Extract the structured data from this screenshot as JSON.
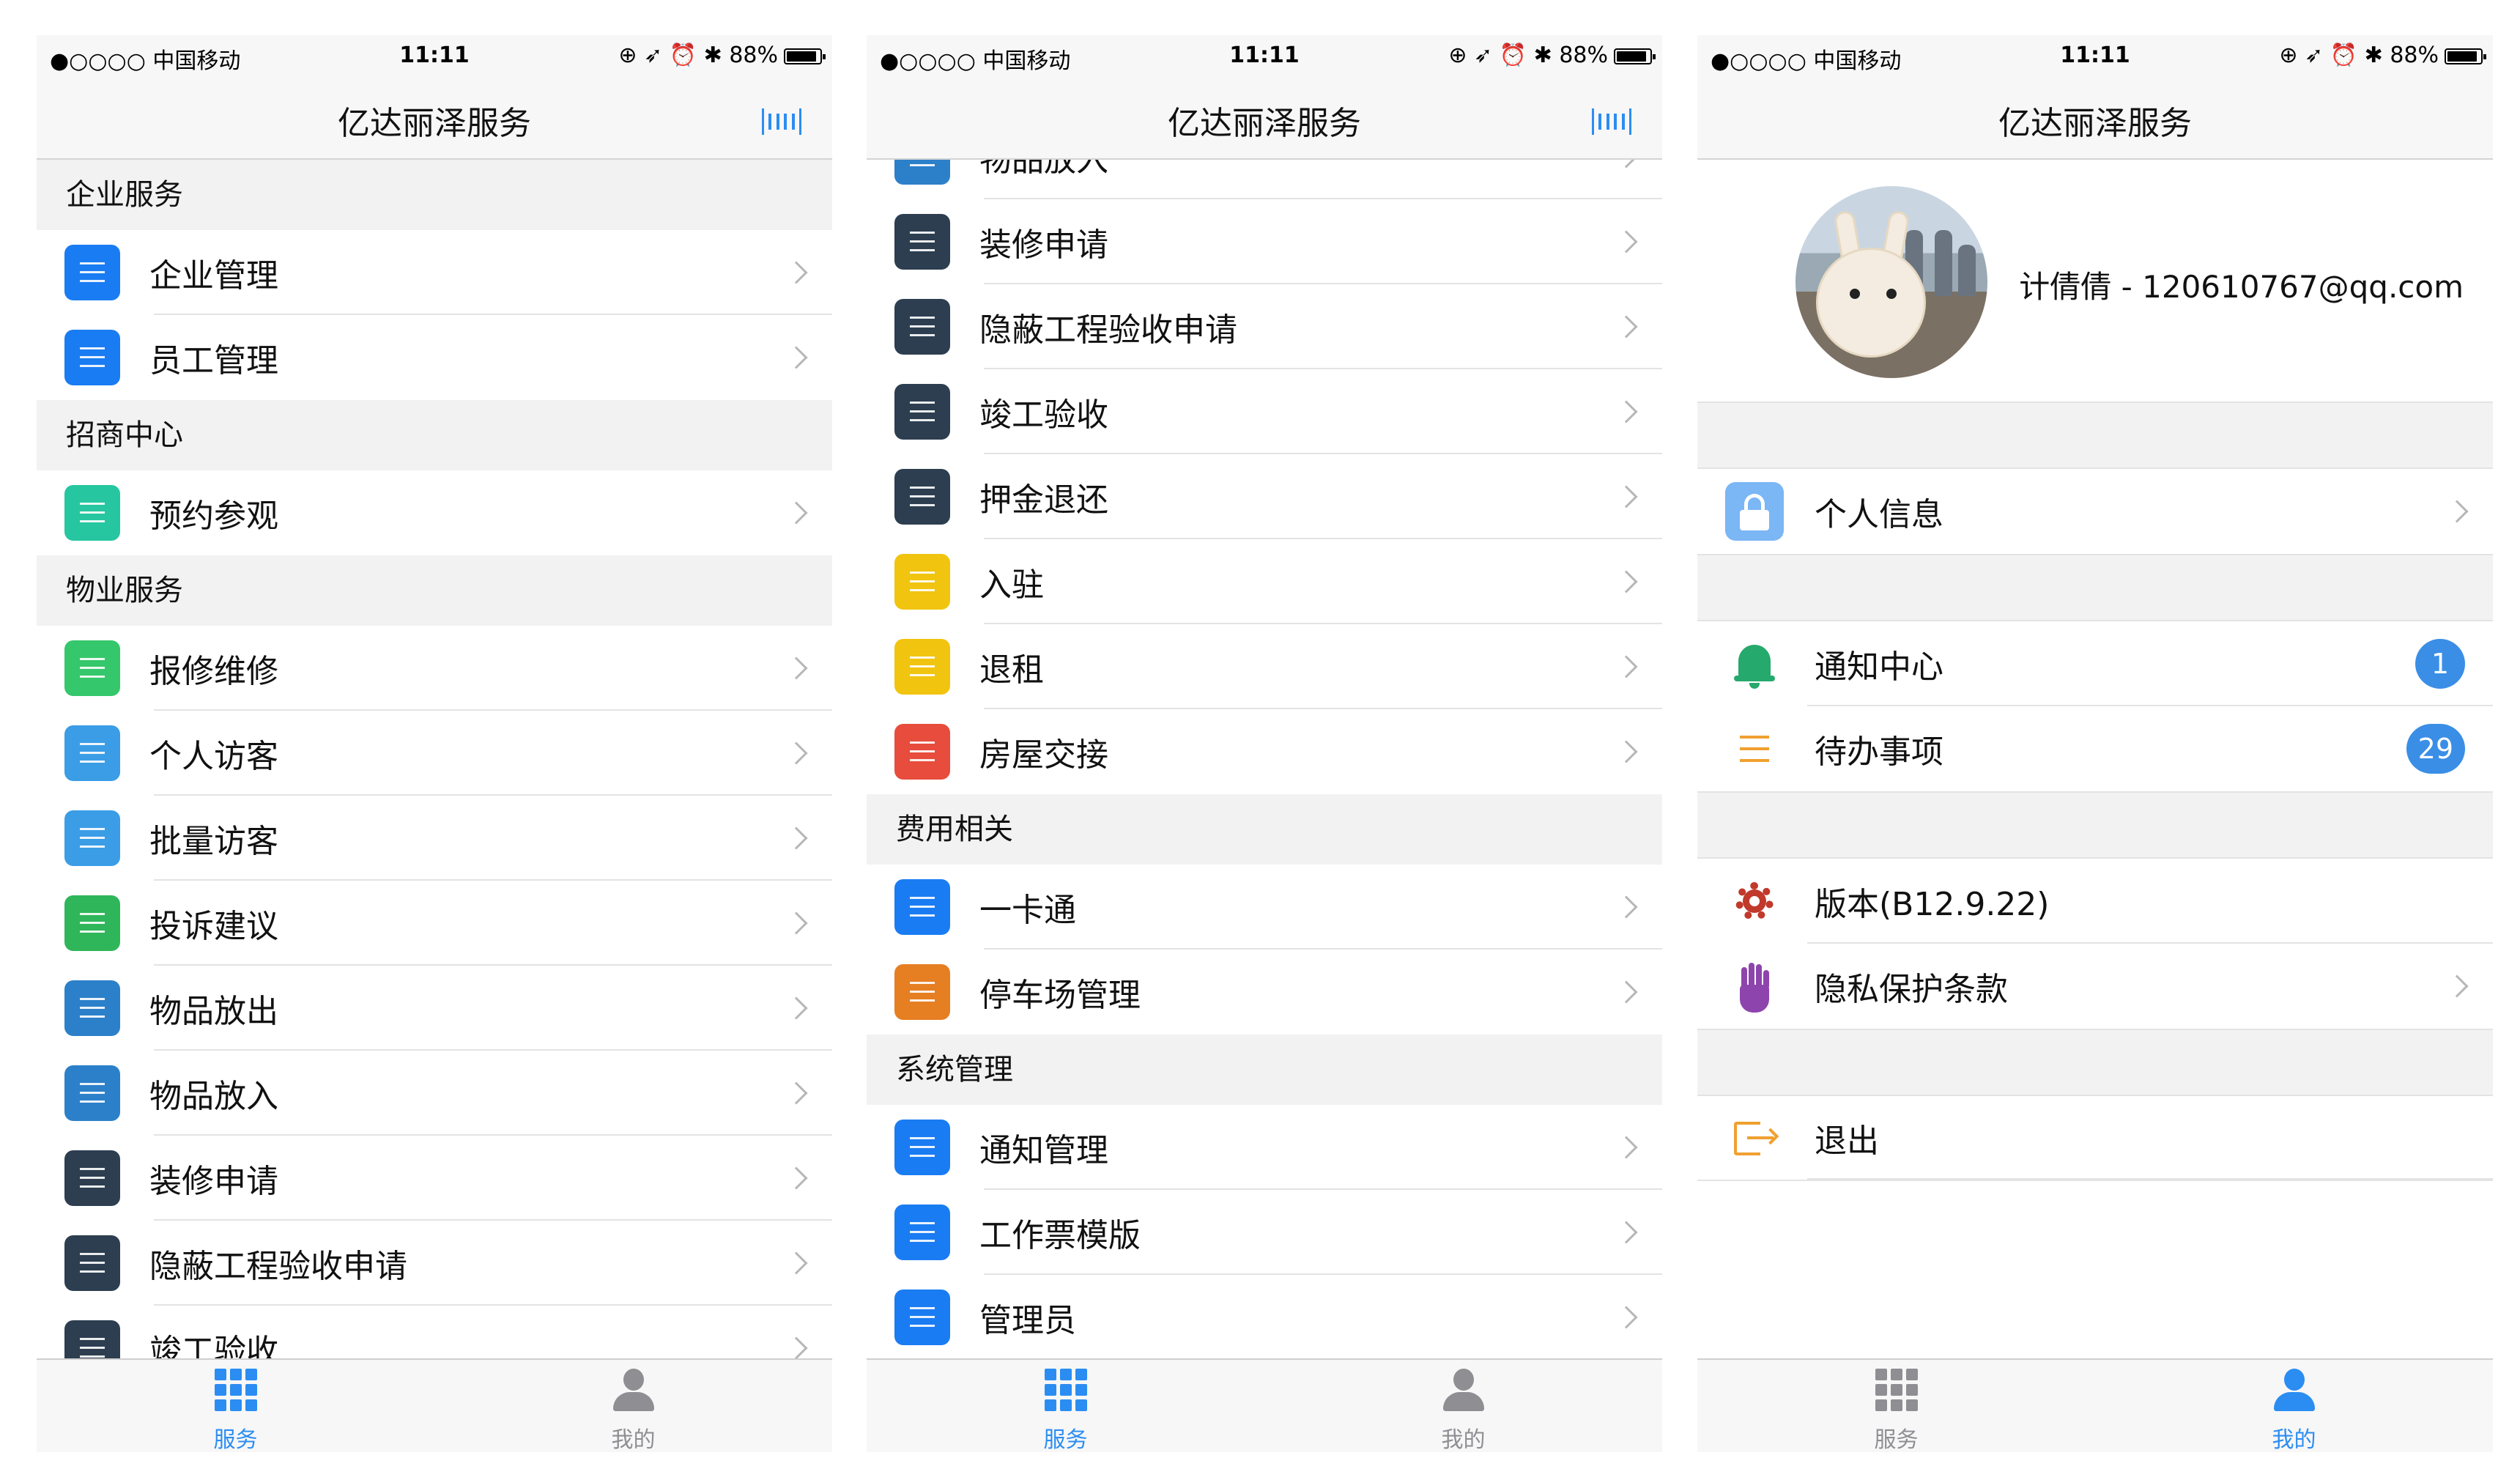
{
  "status_bar": {
    "carrier": "●○○○○ 中国移动",
    "time": "11:11",
    "battery": "88%"
  },
  "app_title": "亿达丽泽服务",
  "screen1": {
    "sections": [
      {
        "title": "企业服务",
        "items": [
          {
            "label": "企业管理",
            "color": "#1a7cf2"
          },
          {
            "label": "员工管理",
            "color": "#1a7cf2"
          }
        ]
      },
      {
        "title": "招商中心",
        "items": [
          {
            "label": "预约参观",
            "color": "#26c6a0"
          }
        ]
      },
      {
        "title": "物业服务",
        "items": [
          {
            "label": "报修维修",
            "color": "#35c76b"
          },
          {
            "label": "个人访客",
            "color": "#3a9de6"
          },
          {
            "label": "批量访客",
            "color": "#3a9de6"
          },
          {
            "label": "投诉建议",
            "color": "#2fb65a"
          },
          {
            "label": "物品放出",
            "color": "#2c80c9"
          },
          {
            "label": "物品放入",
            "color": "#2c80c9"
          },
          {
            "label": "装修申请",
            "color": "#2c3e50"
          },
          {
            "label": "隐蔽工程验收申请",
            "color": "#2c3e50"
          },
          {
            "label": "竣工验收",
            "color": "#2c3e50"
          }
        ]
      }
    ]
  },
  "screen2": {
    "sections": [
      {
        "title": "",
        "items": [
          {
            "label": "物品放入",
            "color": "#2c80c9"
          },
          {
            "label": "装修申请",
            "color": "#2c3e50"
          },
          {
            "label": "隐蔽工程验收申请",
            "color": "#2c3e50"
          },
          {
            "label": "竣工验收",
            "color": "#2c3e50"
          },
          {
            "label": "押金退还",
            "color": "#2c3e50"
          },
          {
            "label": "入驻",
            "color": "#f1c40f"
          },
          {
            "label": "退租",
            "color": "#f1c40f"
          },
          {
            "label": "房屋交接",
            "color": "#e74c3c"
          }
        ]
      },
      {
        "title": "费用相关",
        "items": [
          {
            "label": "一卡通",
            "color": "#1a7cf2"
          },
          {
            "label": "停车场管理",
            "color": "#e67e22"
          }
        ]
      },
      {
        "title": "系统管理",
        "items": [
          {
            "label": "通知管理",
            "color": "#1a7cf2"
          },
          {
            "label": "工作票模版",
            "color": "#1a7cf2"
          },
          {
            "label": "管理员",
            "color": "#1a7cf2"
          }
        ]
      }
    ]
  },
  "screen3": {
    "user": "计倩倩 - 120610767@qq.com",
    "personal_info": "个人信息",
    "notification_center": "通知中心",
    "notification_count": "1",
    "todo": "待办事项",
    "todo_count": "29",
    "version": "版本(B12.9.22)",
    "privacy": "隐私保护条款",
    "logout": "退出"
  },
  "tabs": {
    "service": "服务",
    "mine": "我的"
  },
  "colors": {
    "accent": "#2b8df2",
    "inactive": "#8e8e93"
  }
}
